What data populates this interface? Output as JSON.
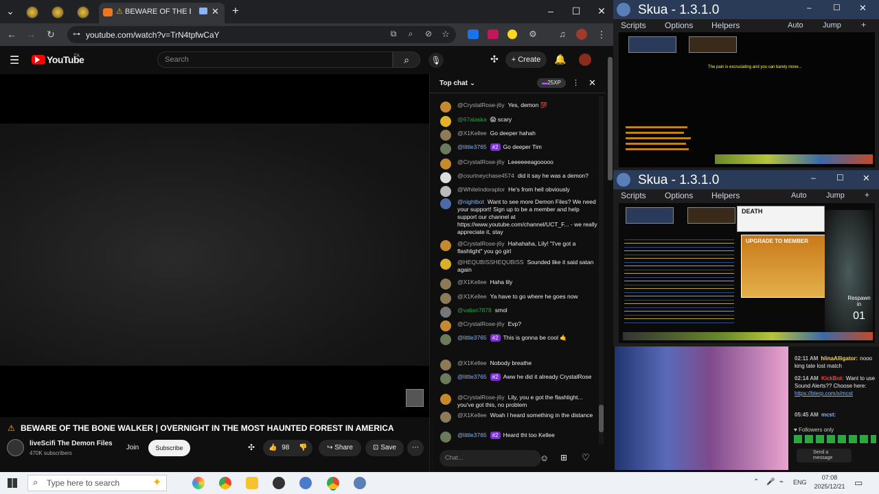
{
  "browser": {
    "active_tab_title": "BEWARE OF THE BONE WALKER",
    "url": "youtube.com/watch?v=TrN4tpfwCaY"
  },
  "youtube": {
    "logo_text": "YouTube",
    "logo_region": "ZA",
    "search_placeholder": "Search",
    "create_label": "Create",
    "video_title": "BEWARE OF THE BONE WALKER | OVERNIGHT IN THE MOST HAUNTED FOREST IN AMERICA",
    "channel_name": "liveScifi The Demon Files",
    "subscribers": "470K subscribers",
    "join_label": "Join",
    "subscribe_label": "Subscribe",
    "likes": "98",
    "share_label": "Share",
    "save_label": "Save"
  },
  "chat": {
    "header": "Top chat",
    "xp_badge": "25XP",
    "input_placeholder": "Chat...",
    "messages": [
      {
        "author": "@CrystalRose-j6y",
        "text": "Yes, demon 💯",
        "color": "#aaa",
        "avatar": "#c58a2e"
      },
      {
        "author": "@67alaska",
        "text": "😱 scary",
        "color": "#2ba640",
        "avatar": "#e3b326"
      },
      {
        "author": "@X1Kellee",
        "text": "Go deeper hahah",
        "color": "#aaa",
        "avatar": "#8f7a58"
      },
      {
        "author": "@little3765",
        "badge": "#2",
        "text": "Go deeper Tim",
        "color": "#8ab4f8",
        "avatar": "#6c7a5c"
      },
      {
        "author": "@CrystalRose-j6y",
        "text": "Leeeeeeagooooo",
        "color": "#aaa",
        "avatar": "#c58a2e"
      },
      {
        "author": "@courtneychase4574",
        "text": "did it say he was a demon?",
        "color": "#aaa",
        "avatar": "#ddd"
      },
      {
        "author": "@WhiteIndoraptor",
        "text": "He's from hell obviously",
        "color": "#aaa",
        "avatar": "#bbb"
      },
      {
        "author": "@nightbot",
        "text": "Want to see more Demon Files? We need your support! Sign up to be a member and help support our channel at https://www.youtube.com/channel/UCT_F... - we really appreciate it, stay",
        "color": "#8ab4f8",
        "avatar": "#4a6aa8"
      },
      {
        "author": "@CrystalRose-j6y",
        "text": "Hahahaha, Lily! \"I've got a flashlight\" you go girl",
        "color": "#aaa",
        "avatar": "#c58a2e"
      },
      {
        "author": "@HEQUBISSHEQUBISS",
        "text": "Sounded like it said satan again",
        "color": "#aaa",
        "avatar": "#d9b02a"
      },
      {
        "author": "@X1Kellee",
        "text": "Haha lily",
        "color": "#aaa",
        "avatar": "#8f7a58"
      },
      {
        "author": "@X1Kellee",
        "text": "Ya have to go where he goes now",
        "color": "#aaa",
        "avatar": "#8f7a58"
      },
      {
        "author": "@valian7878",
        "text": "smol",
        "color": "#2ba640",
        "avatar": "#777"
      },
      {
        "author": "@CrystalRose-j6y",
        "text": "Evp?",
        "color": "#aaa",
        "avatar": "#c58a2e"
      },
      {
        "author": "@little3765",
        "badge": "#2",
        "text": "This is gonna be cool 🤙",
        "color": "#8ab4f8",
        "avatar": "#6c7a5c"
      },
      {
        "author": "@X1Kellee",
        "text": "Nobody breathe",
        "color": "#aaa",
        "avatar": "#8f7a58"
      },
      {
        "author": "@little3765",
        "badge": "#2",
        "text": "Aww he did it already CrystalRose",
        "color": "#8ab4f8",
        "avatar": "#6c7a5c"
      },
      {
        "author": "@CrystalRose-j6y",
        "text": "Lily, you e got the flashlight... you've got this, no problem",
        "color": "#aaa",
        "avatar": "#c58a2e"
      },
      {
        "author": "@X1Kellee",
        "text": "Woah I heard something in the distance",
        "color": "#aaa",
        "avatar": "#8f7a58"
      },
      {
        "author": "@little3765",
        "badge": "#2",
        "text": "Heard tht too Kellee",
        "color": "#8ab4f8",
        "avatar": "#6c7a5c"
      }
    ]
  },
  "skua1": {
    "title": "Skua - 1.3.1.0",
    "menu": [
      "Scripts",
      "Options",
      "Helpers"
    ],
    "auto": "Auto",
    "jump": "Jump",
    "game_message": "The pain is excruciating and you can barely move..."
  },
  "skua2": {
    "title": "Skua - 1.3.1.0",
    "menu": [
      "Scripts",
      "Options",
      "Helpers"
    ],
    "auto": "Auto",
    "jump": "Jump",
    "npc_title": "DEATH",
    "upgrade_banner": "UPGRADE TO MEMBER",
    "respawn": "Respawn in",
    "respawn_count": "01"
  },
  "twitch_chat": [
    {
      "time": "02:11 AM",
      "user": "hlinaAlligator:",
      "text": "nooo king tate lost match",
      "color": "#fcd34d"
    },
    {
      "time": "02:14 AM",
      "user": "KickBot:",
      "text": "Want to use Sound Alerts?? Choose here:",
      "link": "https://bterp.com/x/mcst",
      "color": "#ef4444"
    },
    {
      "time": "05:45 AM",
      "user": "mcst:",
      "text": "",
      "color": "#8ab4f8"
    }
  ],
  "twitch_footer": {
    "followers_only": "Followers only",
    "send_message": "Send a message"
  },
  "taskbar": {
    "search_placeholder": "Type here to search",
    "lang": "ENG",
    "time": "07:08",
    "date": "2025/12/21"
  }
}
